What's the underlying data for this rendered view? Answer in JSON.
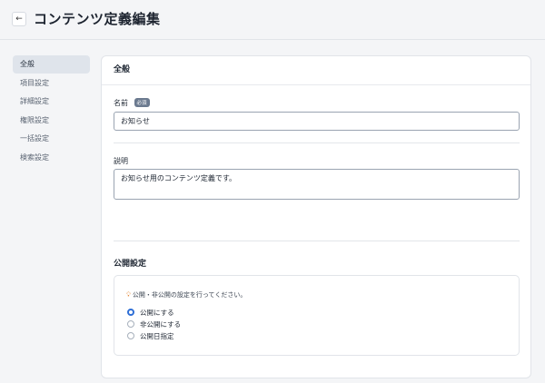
{
  "header": {
    "back_icon": "←",
    "title": "コンテンツ定義編集"
  },
  "sidebar": {
    "items": [
      {
        "label": "全般",
        "active": true
      },
      {
        "label": "項目設定",
        "active": false
      },
      {
        "label": "詳細設定",
        "active": false
      },
      {
        "label": "権限設定",
        "active": false
      },
      {
        "label": "一括設定",
        "active": false
      },
      {
        "label": "検索設定",
        "active": false
      }
    ]
  },
  "general": {
    "section_title": "全般",
    "name_label": "名前",
    "required_badge": "必須",
    "name_value": "お知らせ",
    "description_label": "説明",
    "description_value": "お知らせ用のコンテンツ定義です。"
  },
  "publish": {
    "section_title": "公開設定",
    "hint_icon": "lightbulb-icon",
    "hint": "公開・非公開の設定を行ってください。",
    "options": [
      {
        "label": "公開にする",
        "checked": true
      },
      {
        "label": "非公開にする",
        "checked": false
      },
      {
        "label": "公開日指定",
        "checked": false
      }
    ]
  },
  "colors": {
    "accent": "#2f6fd6",
    "badge": "#6b7a8f",
    "hint_icon": "#e5893a"
  }
}
